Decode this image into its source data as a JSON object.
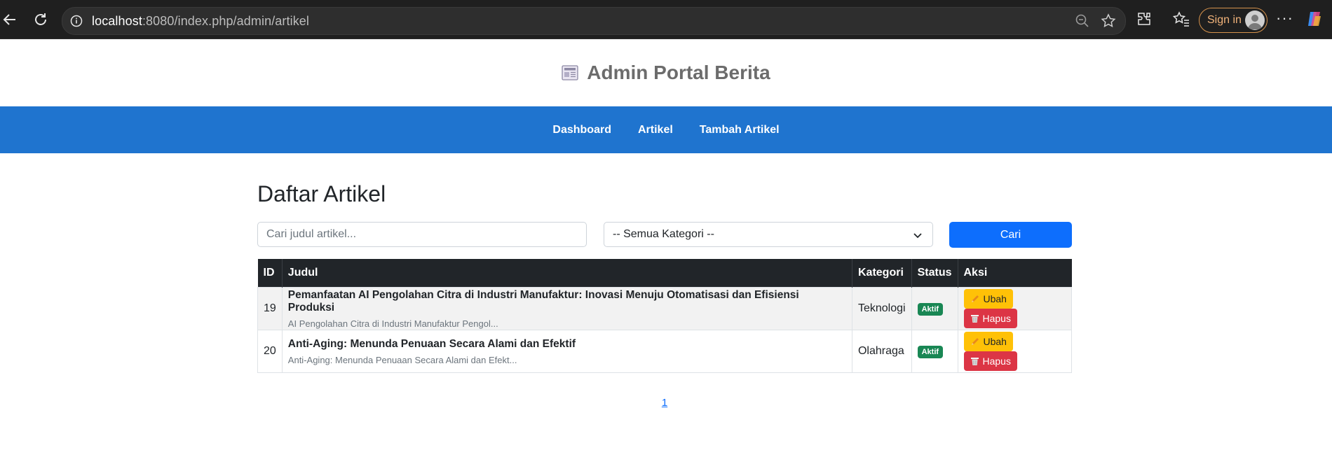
{
  "browser": {
    "url_host": "localhost",
    "url_rest": ":8080/index.php/admin/artikel",
    "signin_label": "Sign in"
  },
  "header": {
    "title": "Admin Portal Berita"
  },
  "nav": {
    "items": [
      "Dashboard",
      "Artikel",
      "Tambah Artikel"
    ]
  },
  "main": {
    "title": "Daftar Artikel",
    "search_placeholder": "Cari judul artikel...",
    "category_selected": "-- Semua Kategori --",
    "search_button": "Cari",
    "columns": [
      "ID",
      "Judul",
      "Kategori",
      "Status",
      "Aksi"
    ],
    "rows": [
      {
        "id": "19",
        "title": "Pemanfaatan AI Pengolahan Citra di Industri Manufaktur: Inovasi Menuju Otomatisasi dan Efisiensi Produksi",
        "excerpt": "AI Pengolahan Citra di Industri Manufaktur Pengol...",
        "category": "Teknologi",
        "status": "Aktif",
        "edit_label": "Ubah",
        "delete_label": "Hapus"
      },
      {
        "id": "20",
        "title": "Anti-Aging: Menunda Penuaan Secara Alami dan Efektif",
        "excerpt": "Anti-Aging: Menunda Penuaan Secara Alami dan Efekt...",
        "category": "Olahraga",
        "status": "Aktif",
        "edit_label": "Ubah",
        "delete_label": "Hapus"
      }
    ],
    "pagination": [
      "1"
    ]
  },
  "colors": {
    "nav_bg": "#1f74cf",
    "primary_button": "#0d6efd",
    "badge_active": "#198754",
    "edit_button": "#ffc107",
    "delete_button": "#dc3545",
    "table_head": "#212529"
  },
  "icons": [
    "back-icon",
    "reload-icon",
    "info-icon",
    "zoom-out-icon",
    "star-icon",
    "extensions-icon",
    "favorites-icon",
    "avatar-icon",
    "more-icon",
    "copilot-icon",
    "newspaper-icon",
    "chevron-down-icon",
    "pencil-icon",
    "trash-icon"
  ]
}
